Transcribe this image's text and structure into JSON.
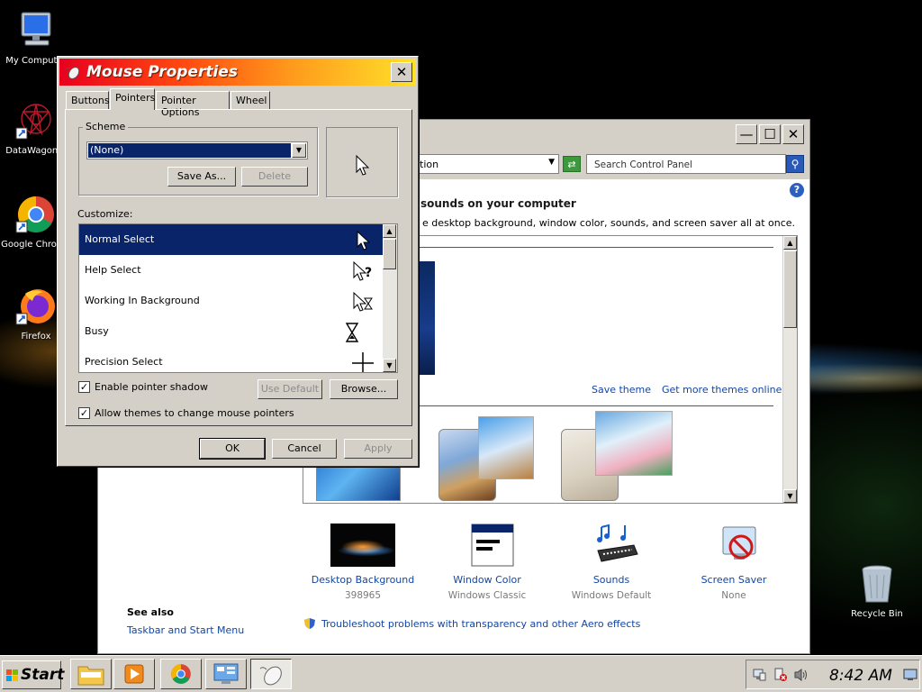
{
  "desktop": {
    "icons": [
      {
        "label": "My Computer"
      },
      {
        "label": "DataWagon..."
      },
      {
        "label": "Google Chrome"
      },
      {
        "label": "Firefox"
      },
      {
        "label": "Recycle Bin"
      }
    ]
  },
  "control_panel": {
    "address_text": "tion",
    "search_placeholder": "Search Control Panel",
    "heading": "sounds on your computer",
    "subheading": "e desktop background, window color, sounds, and screen saver all at once.",
    "save_theme": "Save theme",
    "get_more_themes": "Get more themes online",
    "bottom_items": [
      {
        "title": "Desktop Background",
        "subtitle": "398965"
      },
      {
        "title": "Window Color",
        "subtitle": "Windows Classic"
      },
      {
        "title": "Sounds",
        "subtitle": "Windows Default"
      },
      {
        "title": "Screen Saver",
        "subtitle": "None"
      }
    ],
    "see_also_label": "See also",
    "see_also_link": "Taskbar and Start Menu",
    "troubleshoot_link": "Troubleshoot problems with transparency and other Aero effects"
  },
  "mouse_properties": {
    "title": "Mouse Properties",
    "tabs": [
      {
        "label": "Buttons"
      },
      {
        "label": "Pointers"
      },
      {
        "label": "Pointer Options"
      },
      {
        "label": "Wheel"
      }
    ],
    "scheme_label": "Scheme",
    "scheme_value": "(None)",
    "save_as_button": "Save As...",
    "delete_button": "Delete",
    "customize_label": "Customize:",
    "pointers": [
      {
        "label": "Normal Select"
      },
      {
        "label": "Help Select"
      },
      {
        "label": "Working In Background"
      },
      {
        "label": "Busy"
      },
      {
        "label": "Precision Select"
      }
    ],
    "enable_shadow_label": "Enable pointer shadow",
    "use_default_button": "Use Default",
    "browse_button": "Browse...",
    "allow_themes_label": "Allow themes to change mouse pointers",
    "ok_button": "OK",
    "cancel_button": "Cancel",
    "apply_button": "Apply"
  },
  "taskbar": {
    "start_label": "Start",
    "clock": "8:42 AM"
  }
}
